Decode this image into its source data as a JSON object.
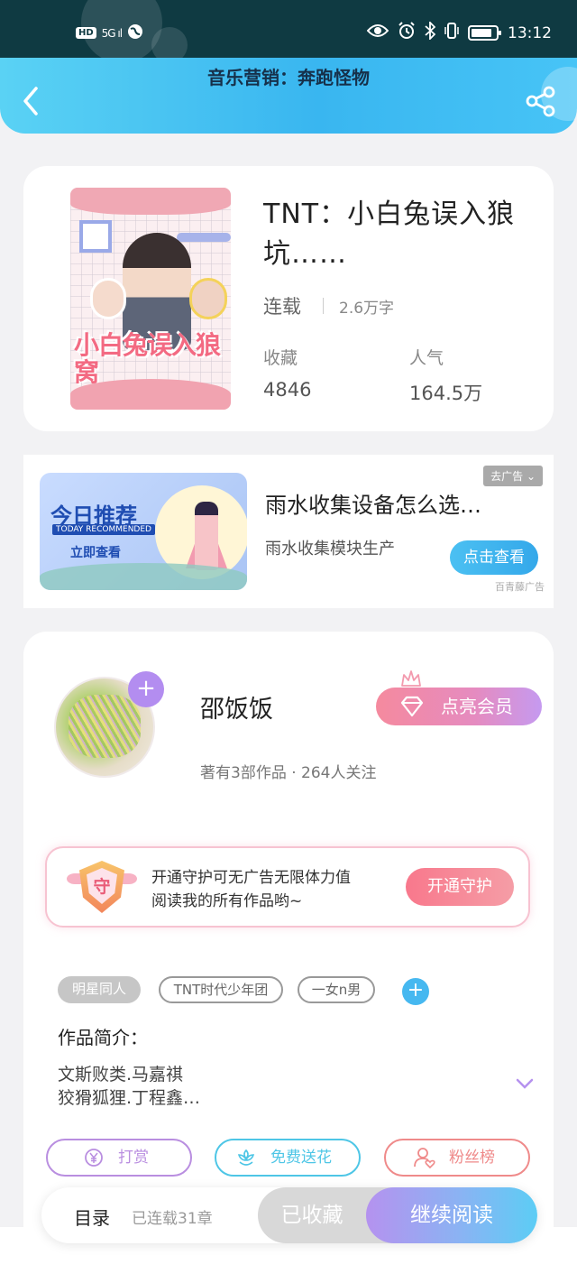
{
  "status_bar": {
    "left_hd": "HD",
    "left_signal": "5G ıl",
    "time": "13:12"
  },
  "header": {
    "title": "音乐营销：奔跑怪物"
  },
  "book": {
    "cover_title": "小白兔误入狼窝",
    "title": "TNT：小白兔误入狼坑……",
    "status": "连载",
    "words": "2.6万字",
    "favorites_label": "收藏",
    "favorites_value": "4846",
    "popularity_label": "人气",
    "popularity_value": "164.5万"
  },
  "ad": {
    "image_big": "今日推荐",
    "image_en": "TODAY RECOMMENDED",
    "image_small": "立即查看",
    "remove_label": "去广告 ⌄",
    "title": "雨水收集设备怎么选…",
    "desc": "雨水收集模块生产",
    "button": "点击查看",
    "source": "百青藤广告"
  },
  "author": {
    "name": "邵饭饭",
    "meta": "著有3部作品 · 264人关注",
    "follow_plus": "+",
    "vip_button": "点亮会员"
  },
  "guard": {
    "shield_char": "守",
    "text_line1": "开通守护可无广告无限体力值",
    "text_line2": "阅读我的所有作品哟~",
    "button": "开通守护"
  },
  "tags": [
    "明星同人",
    "TNT时代少年团",
    "一女n男"
  ],
  "tag_add": "+",
  "intro": {
    "title": "作品简介：",
    "line1": "文斯败类.马嘉祺",
    "line2": "狡猾狐狸.丁程鑫…"
  },
  "actions": [
    {
      "label": "打赏",
      "color": "#b98ee0"
    },
    {
      "label": "免费送花",
      "color": "#4ec6e6"
    },
    {
      "label": "粉丝榜",
      "color": "#ef8a8a"
    }
  ],
  "bottom_bar": {
    "toc": "目录",
    "serial": "已连载31章",
    "collected": "已收藏",
    "continue": "继续阅读"
  },
  "colors": {
    "header_blue": "#39b6f0",
    "vip_pink": "#f58a9e",
    "continue_purple": "#b592ef"
  }
}
